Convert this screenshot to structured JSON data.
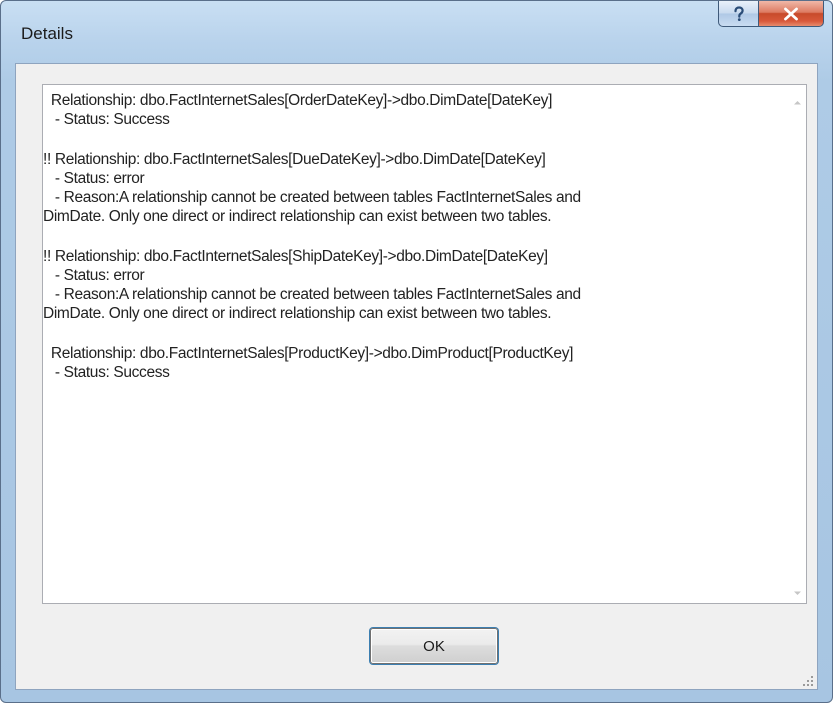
{
  "window": {
    "title": "Details",
    "help_glyph": "?",
    "close_glyph": "x"
  },
  "details": {
    "entries": [
      {
        "lines": [
          "  Relationship: dbo.FactInternetSales[OrderDateKey]->dbo.DimDate[DateKey]",
          "   - Status: Success"
        ]
      },
      {
        "lines": [
          "!! Relationship: dbo.FactInternetSales[DueDateKey]->dbo.DimDate[DateKey]",
          "   - Status: error",
          "   - Reason:A relationship cannot be created between tables FactInternetSales and",
          "DimDate. Only one direct or indirect relationship can exist between two tables."
        ]
      },
      {
        "lines": [
          "!! Relationship: dbo.FactInternetSales[ShipDateKey]->dbo.DimDate[DateKey]",
          "   - Status: error",
          "   - Reason:A relationship cannot be created between tables FactInternetSales and",
          "DimDate. Only one direct or indirect relationship can exist between two tables."
        ]
      },
      {
        "lines": [
          "  Relationship: dbo.FactInternetSales[ProductKey]->dbo.DimProduct[ProductKey]",
          "   - Status: Success"
        ]
      }
    ]
  },
  "buttons": {
    "ok_label": "OK"
  },
  "icons": {
    "help": "question-mark-icon",
    "close": "close-x-icon",
    "scroll_up": "scroll-up-arrow-icon",
    "scroll_down": "scroll-down-arrow-icon",
    "resize": "resize-grip-icon"
  },
  "colors": {
    "frame": "#b9d3ec",
    "close_button": "#c74a2b",
    "client_background": "#f0f0f0",
    "button_focus": "#3c7fb1"
  }
}
